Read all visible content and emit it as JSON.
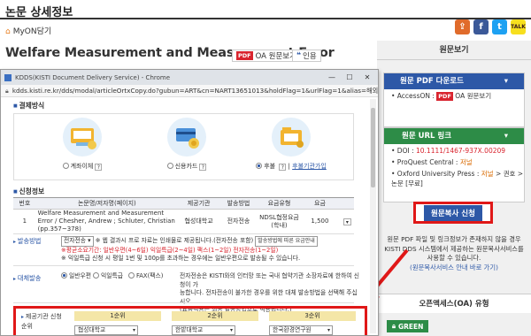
{
  "page": {
    "title": "논문 상세정보",
    "breadcrumb": "MyON담기",
    "paper_title": "Welfare Measurement and Measurement Error",
    "oa_button": "OA 원문보기",
    "pdf_badge": "PDF",
    "cite_button": "인용"
  },
  "share_icons": [
    "share-icon",
    "facebook-icon",
    "twitter-icon",
    "kakaotalk-icon"
  ],
  "sidebar": {
    "header": "원문보기",
    "pdf_panel": {
      "bar": "원문 PDF 다운로드",
      "line": "• AccessON : ",
      "oa_label": "OA 원문보기"
    },
    "url_panel": {
      "bar": "원문 URL 링크",
      "doi_prefix": "• DOI : ",
      "doi": "10.1111/1467-937X.00209",
      "proquest": "• ProQuest Central : ",
      "proquest_tag": "저널",
      "oxford": "• Oxford University Press : ",
      "oxford_tag": "저널",
      "oxford_rest": "> 권호 > 논문 [무료]"
    },
    "orig_copy_button": "원문복사 신청",
    "description": "원문 PDF 파일 및 링크정보가 존재하지 않을 경우 KISTI DDS 시스템에서 제공하는 원문복사서비스를 사용할 수 있습니다.",
    "guide_link": "(원문복사서비스 안내 바로 가기)",
    "oa_header": "오픈액세스(OA) 유형",
    "green_badge": "GREEN"
  },
  "popup": {
    "window_title": "KDDS(KISTI Document Delivery Service) - Chrome",
    "url": "kdds.kisti.re.kr/dds/modal/articleOrtxCopy.do?gubun=ART&cn=NART13651013&holdFlag=1&urlFlag=1&alias=해외...",
    "payment_section": "결제방식",
    "payment_options": [
      {
        "label": "계좌이체",
        "selected": false
      },
      {
        "label": "신용카드",
        "selected": false
      },
      {
        "label": "후불",
        "selected": true,
        "extra": "후불기관가입"
      }
    ],
    "request_section": "신청정보",
    "table": {
      "headers": [
        "번호",
        "논문명/저자명(페이지)",
        "제공기관",
        "발송방법",
        "요금유형",
        "요금",
        ""
      ],
      "rows": [
        {
          "no": "1",
          "title": "Welfare Measurement and Measurement Error / Chesher, Andrew ; Schluter, Christian (pp.357~378)",
          "provider": "협성대학교",
          "method": "전자전송",
          "fee_type": "NDSL협정요금(학내)",
          "fee": "1,500"
        }
      ]
    },
    "delivery_label": "발송방법",
    "delivery_select": "전자전송",
    "delivery_note1": "※ 웹 결과시 프로 자료는 인쇄물로 제공됩니다.(전자전송 포함)",
    "delivery_btn": "발송방법에 따른 요금안내",
    "delivery_note2": "※평균소요기간: 일반우편(4~6일) 익일특급(2~4일) 팩스(1~2일) 전자전송(1~2일)",
    "delivery_note3": "※ 익일특급 신청 시 평일 1번 및 100p를 초과하는 경우에는 일반우편으로 발송될 수 있습니다.",
    "alt_label": "대체발송",
    "alt_options": [
      {
        "label": "일반우편",
        "selected": true
      },
      {
        "label": "익일특급",
        "selected": false
      },
      {
        "label": "FAX(팩스)",
        "selected": false
      }
    ],
    "alt_note1": "전자전송은 KISTI와의 인터망 또는 국내 협약기관 소장자료에 한하여 신청이 가",
    "alt_note2": "능합니다. 전자전송이 불가한 경우를 위한 대체 발송방법을 선택해 주십시오.",
    "alt_note3": "(요금적용은 최종 발송방법으로 적용됩니다.)",
    "rank_label": "제공기관 신청순위",
    "ranks": [
      {
        "head": "1순위",
        "value": "협성대학교"
      },
      {
        "head": "2순위",
        "value": "한밭대학교"
      },
      {
        "head": "3순위",
        "value": "한국환경연구원"
      }
    ]
  },
  "colors": {
    "accent_blue": "#2d58a7",
    "accent_green": "#2d8c47",
    "highlight_red": "#e01818"
  }
}
